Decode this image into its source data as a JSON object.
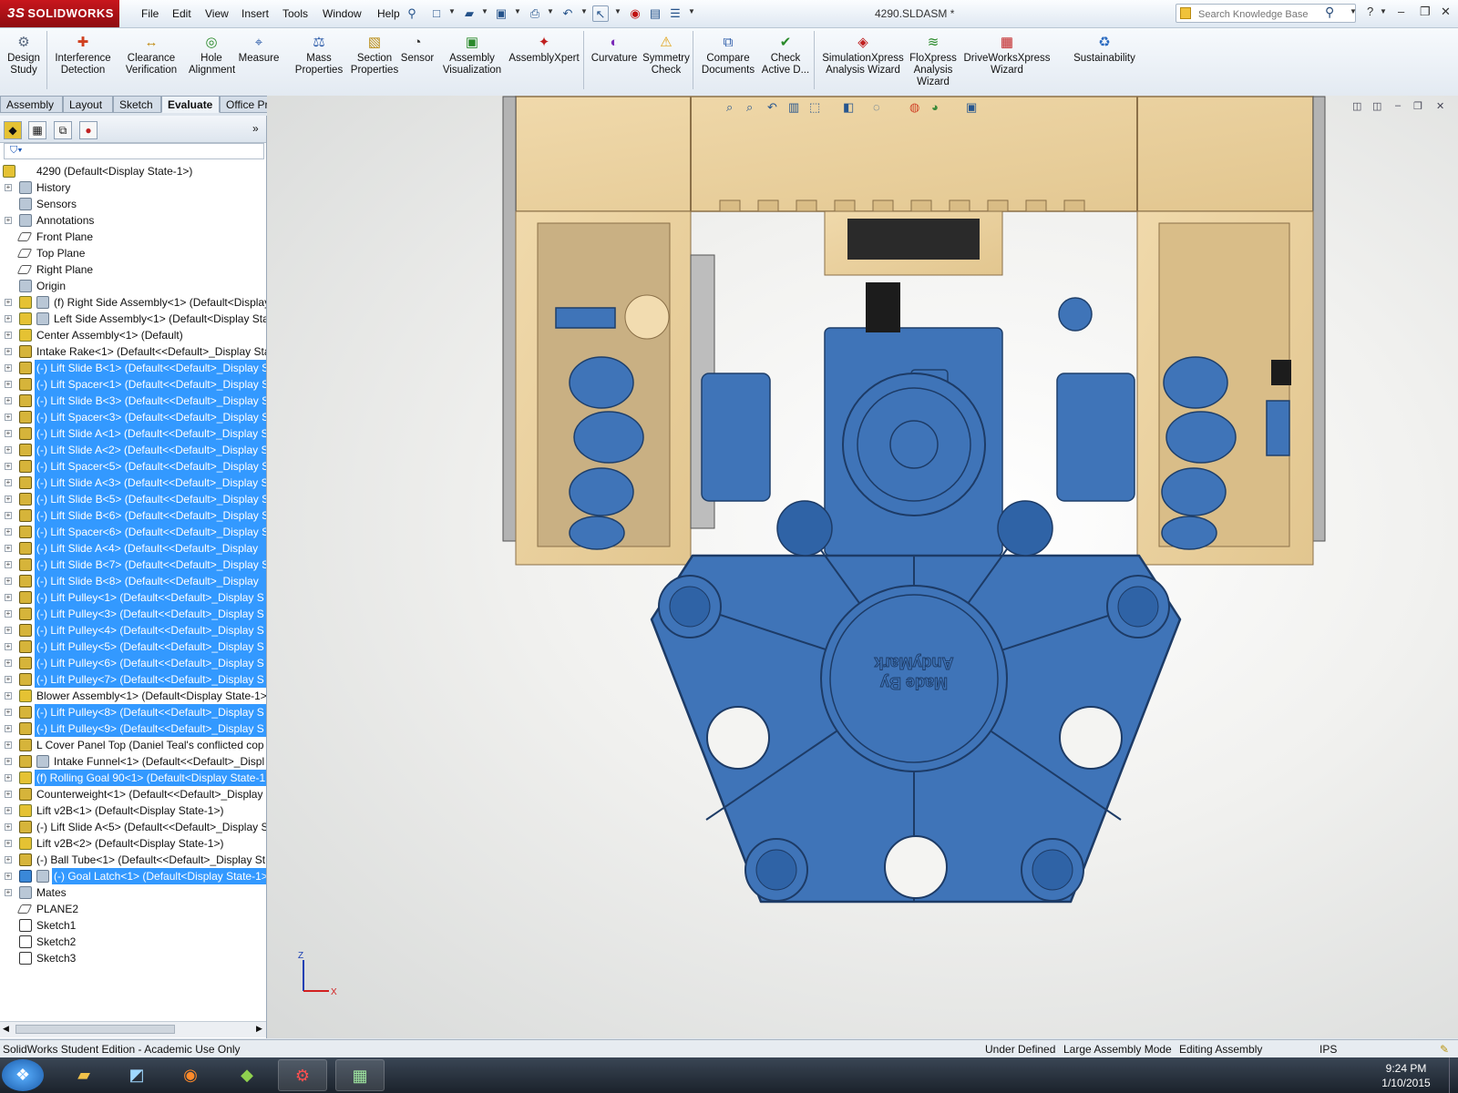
{
  "app": {
    "logo": "SOLIDWORKS",
    "doc_title": "4290.SLDASM *"
  },
  "menu": [
    "File",
    "Edit",
    "View",
    "Insert",
    "Tools",
    "Window",
    "Help"
  ],
  "search": {
    "placeholder": "Search Knowledge Base"
  },
  "command_manager": [
    {
      "label1": "Design",
      "label2": "Study",
      "icon": "design-study-icon"
    },
    {
      "label1": "Interference",
      "label2": "Detection",
      "icon": "interference-icon"
    },
    {
      "label1": "Clearance",
      "label2": "Verification",
      "icon": "clearance-icon"
    },
    {
      "label1": "Hole",
      "label2": "Alignment",
      "icon": "hole-alignment-icon"
    },
    {
      "label1": "Measure",
      "label2": "",
      "icon": "measure-icon"
    },
    {
      "label1": "Mass",
      "label2": "Properties",
      "icon": "mass-properties-icon"
    },
    {
      "label1": "Section",
      "label2": "Properties",
      "icon": "section-properties-icon"
    },
    {
      "label1": "Sensor",
      "label2": "",
      "icon": "sensor-icon"
    },
    {
      "label1": "Assembly",
      "label2": "Visualization",
      "icon": "assembly-visualization-icon"
    },
    {
      "label1": "AssemblyXpert",
      "label2": "",
      "icon": "assemblyxpert-icon"
    },
    {
      "label1": "Curvature",
      "label2": "",
      "icon": "curvature-icon"
    },
    {
      "label1": "Symmetry",
      "label2": "Check",
      "icon": "symmetry-icon"
    },
    {
      "label1": "Compare",
      "label2": "Documents",
      "icon": "compare-icon"
    },
    {
      "label1": "Check",
      "label2": "Active D...",
      "icon": "check-active-icon"
    },
    {
      "label1": "SimulationXpress",
      "label2": "Analysis Wizard",
      "icon": "simulation-icon"
    },
    {
      "label1": "FloXpress",
      "label2": "Analysis",
      "label3": "Wizard",
      "icon": "floxpress-icon"
    },
    {
      "label1": "DriveWorksXpress",
      "label2": "Wizard",
      "icon": "driveworks-icon"
    },
    {
      "label1": "Sustainability",
      "label2": "",
      "icon": "sustainability-icon"
    }
  ],
  "tabs": [
    "Assembly",
    "Layout",
    "Sketch",
    "Evaluate",
    "Office Products"
  ],
  "active_tab": "Evaluate",
  "tree": [
    {
      "label": "4290  (Default<Display State-1>)",
      "icon": "asm",
      "selected": false,
      "expander": false,
      "indent": 0
    },
    {
      "label": "History",
      "icon": "gen",
      "selected": false,
      "expander": true,
      "indent": 1
    },
    {
      "label": "Sensors",
      "icon": "gen",
      "selected": false,
      "expander": false,
      "indent": 1
    },
    {
      "label": "Annotations",
      "icon": "gen",
      "selected": false,
      "expander": true,
      "indent": 1
    },
    {
      "label": "Front Plane",
      "icon": "plane",
      "selected": false,
      "expander": false,
      "indent": 1
    },
    {
      "label": "Top Plane",
      "icon": "plane",
      "selected": false,
      "expander": false,
      "indent": 1
    },
    {
      "label": "Right Plane",
      "icon": "plane",
      "selected": false,
      "expander": false,
      "indent": 1
    },
    {
      "label": "Origin",
      "icon": "gen",
      "selected": false,
      "expander": false,
      "indent": 1
    },
    {
      "label": "(f) Right Side Assembly<1> (Default<Display",
      "icon": "asm",
      "selected": false,
      "expander": true,
      "indent": 2
    },
    {
      "label": "Left Side Assembly<1> (Default<Display Sta",
      "icon": "asm",
      "selected": false,
      "expander": true,
      "indent": 2
    },
    {
      "label": "Center Assembly<1> (Default)",
      "icon": "asm",
      "selected": false,
      "expander": true,
      "indent": 1
    },
    {
      "label": "Intake Rake<1> (Default<<Default>_Display Sta",
      "icon": "part",
      "selected": false,
      "expander": true,
      "indent": 1
    },
    {
      "label": "(-) Lift Slide B<1> (Default<<Default>_Display S",
      "icon": "part",
      "selected": true,
      "expander": true,
      "indent": 1
    },
    {
      "label": "(-) Lift Spacer<1> (Default<<Default>_Display S",
      "icon": "part",
      "selected": true,
      "expander": true,
      "indent": 1
    },
    {
      "label": "(-) Lift Slide B<3> (Default<<Default>_Display S",
      "icon": "part",
      "selected": true,
      "expander": true,
      "indent": 1
    },
    {
      "label": "(-) Lift Spacer<3> (Default<<Default>_Display S",
      "icon": "part",
      "selected": true,
      "expander": true,
      "indent": 1
    },
    {
      "label": "(-) Lift Slide A<1> (Default<<Default>_Display S",
      "icon": "part",
      "selected": true,
      "expander": true,
      "indent": 1
    },
    {
      "label": "(-) Lift Slide A<2> (Default<<Default>_Display S",
      "icon": "part",
      "selected": true,
      "expander": true,
      "indent": 1
    },
    {
      "label": "(-) Lift Spacer<5> (Default<<Default>_Display S",
      "icon": "part",
      "selected": true,
      "expander": true,
      "indent": 1
    },
    {
      "label": "(-) Lift Slide A<3> (Default<<Default>_Display S",
      "icon": "part",
      "selected": true,
      "expander": true,
      "indent": 1
    },
    {
      "label": "(-) Lift Slide B<5> (Default<<Default>_Display S",
      "icon": "part",
      "selected": true,
      "expander": true,
      "indent": 1
    },
    {
      "label": "(-) Lift Slide B<6> (Default<<Default>_Display S",
      "icon": "part",
      "selected": true,
      "expander": true,
      "indent": 1
    },
    {
      "label": "(-) Lift Spacer<6> (Default<<Default>_Display S",
      "icon": "part",
      "selected": true,
      "expander": true,
      "indent": 1
    },
    {
      "label": "(-) Lift Slide A<4> (Default<<Default>_Display",
      "icon": "part",
      "selected": true,
      "expander": true,
      "indent": 1
    },
    {
      "label": "(-) Lift Slide B<7> (Default<<Default>_Display S",
      "icon": "part",
      "selected": true,
      "expander": true,
      "indent": 1
    },
    {
      "label": "(-) Lift Slide B<8> (Default<<Default>_Display",
      "icon": "part",
      "selected": true,
      "expander": true,
      "indent": 1
    },
    {
      "label": "(-) Lift Pulley<1> (Default<<Default>_Display S",
      "icon": "part",
      "selected": true,
      "expander": true,
      "indent": 1
    },
    {
      "label": "(-) Lift Pulley<3> (Default<<Default>_Display S",
      "icon": "part",
      "selected": true,
      "expander": true,
      "indent": 1
    },
    {
      "label": "(-) Lift Pulley<4> (Default<<Default>_Display S",
      "icon": "part",
      "selected": true,
      "expander": true,
      "indent": 1
    },
    {
      "label": "(-) Lift Pulley<5> (Default<<Default>_Display S",
      "icon": "part",
      "selected": true,
      "expander": true,
      "indent": 1
    },
    {
      "label": "(-) Lift Pulley<6> (Default<<Default>_Display S",
      "icon": "part",
      "selected": true,
      "expander": true,
      "indent": 1
    },
    {
      "label": "(-) Lift Pulley<7> (Default<<Default>_Display S",
      "icon": "part",
      "selected": true,
      "expander": true,
      "indent": 1
    },
    {
      "label": "Blower Assembly<1> (Default<Display State-1>",
      "icon": "asm",
      "selected": false,
      "expander": true,
      "indent": 1
    },
    {
      "label": "(-) Lift Pulley<8> (Default<<Default>_Display S",
      "icon": "part",
      "selected": true,
      "expander": true,
      "indent": 1
    },
    {
      "label": "(-) Lift Pulley<9> (Default<<Default>_Display S",
      "icon": "part",
      "selected": true,
      "expander": true,
      "indent": 1
    },
    {
      "label": "L Cover Panel Top (Daniel Teal's conflicted cop",
      "icon": "part",
      "selected": false,
      "expander": true,
      "indent": 1
    },
    {
      "label": "Intake Funnel<1> (Default<<Default>_Displ",
      "icon": "part",
      "selected": false,
      "expander": true,
      "indent": 2
    },
    {
      "label": "(f) Rolling Goal 90<1> (Default<Display State-1",
      "icon": "asm",
      "selected": true,
      "expander": true,
      "indent": 1
    },
    {
      "label": "Counterweight<1> (Default<<Default>_Display",
      "icon": "part",
      "selected": false,
      "expander": true,
      "indent": 1
    },
    {
      "label": "Lift v2B<1> (Default<Display State-1>)",
      "icon": "asm",
      "selected": false,
      "expander": true,
      "indent": 1
    },
    {
      "label": "(-) Lift Slide A<5> (Default<<Default>_Display S",
      "icon": "part",
      "selected": false,
      "expander": true,
      "indent": 1
    },
    {
      "label": "Lift v2B<2> (Default<Display State-1>)",
      "icon": "asm",
      "selected": false,
      "expander": true,
      "indent": 1
    },
    {
      "label": "(-) Ball Tube<1> (Default<<Default>_Display St",
      "icon": "part",
      "selected": false,
      "expander": true,
      "indent": 1
    },
    {
      "label": "(-) Goal Latch<1> (Default<Display State-1>",
      "icon": "asm2",
      "selected": true,
      "expander": true,
      "indent": 2
    },
    {
      "label": "Mates",
      "icon": "gen",
      "selected": false,
      "expander": true,
      "indent": 1
    },
    {
      "label": "PLANE2",
      "icon": "plane",
      "selected": false,
      "expander": false,
      "indent": 1
    },
    {
      "label": "Sketch1",
      "icon": "sketch",
      "selected": false,
      "expander": false,
      "indent": 1
    },
    {
      "label": "Sketch2",
      "icon": "sketch",
      "selected": false,
      "expander": false,
      "indent": 1
    },
    {
      "label": "Sketch3",
      "icon": "sketch",
      "selected": false,
      "expander": false,
      "indent": 1
    }
  ],
  "model": {
    "embossed_text_line1": "Made By",
    "embossed_text_line2": "AndyMark",
    "part_color": "#3f74b8",
    "wood_color": "#e9cf9c"
  },
  "triad": {
    "z": "Z",
    "x": "X"
  },
  "status": {
    "edition": "SolidWorks Student Edition - Academic Use Only",
    "state": "Under Defined",
    "mode": "Large Assembly Mode",
    "editing": "Editing Assembly",
    "units": "IPS"
  },
  "taskbar": {
    "time": "9:24 PM",
    "date": "1/10/2015",
    "apps": [
      "start-orb-icon",
      "file-explorer-icon",
      "notes-icon",
      "firefox-icon",
      "qt-icon",
      "solidworks-icon",
      "task-manager-icon"
    ]
  }
}
